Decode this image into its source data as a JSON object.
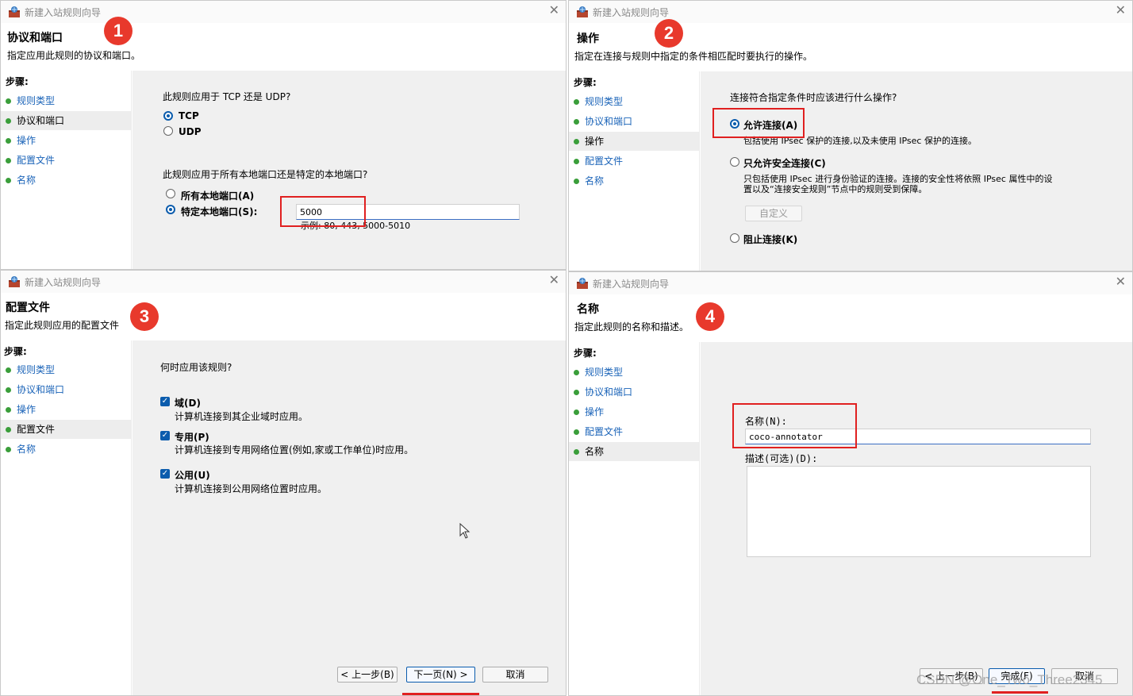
{
  "window_title": "新建入站规则向导",
  "close_glyph": "✕",
  "steps_label": "步骤:",
  "steps": [
    "规则类型",
    "协议和端口",
    "操作",
    "配置文件",
    "名称"
  ],
  "badges": [
    "1",
    "2",
    "3",
    "4"
  ],
  "panel1": {
    "header_title": "协议和端口",
    "header_sub": "指定应用此规则的协议和端口。",
    "q1": "此规则应用于 TCP 还是 UDP?",
    "opt_tcp": "TCP",
    "opt_udp": "UDP",
    "q2": "此规则应用于所有本地端口还是特定的本地端口?",
    "opt_all_ports": "所有本地端口(A)",
    "opt_specific_ports": "特定本地端口(S):",
    "port_value": "5000",
    "port_example": "示例: 80, 443, 5000-5010"
  },
  "panel2": {
    "header_title": "操作",
    "header_sub": "指定在连接与规则中指定的条件相匹配时要执行的操作。",
    "question": "连接符合指定条件时应该进行什么操作?",
    "opt_allow": "允许连接(A)",
    "opt_allow_desc": "包括使用 IPsec 保护的连接,以及未使用 IPsec 保护的连接。",
    "opt_secure": "只允许安全连接(C)",
    "opt_secure_desc_1": "只包括使用 IPsec 进行身份验证的连接。连接的安全性将依照 IPsec 属性中的设",
    "opt_secure_desc_2": "置以及“连接安全规则”节点中的规则受到保障。",
    "customize_button": "自定义",
    "opt_block": "阻止连接(K)"
  },
  "panel3": {
    "header_title": "配置文件",
    "header_sub": "指定此规则应用的配置文件",
    "question": "何时应用该规则?",
    "domain_label": "域(D)",
    "domain_desc": "计算机连接到其企业域时应用。",
    "private_label": "专用(P)",
    "private_desc": "计算机连接到专用网络位置(例如,家或工作单位)时应用。",
    "public_label": "公用(U)",
    "public_desc": "计算机连接到公用网络位置时应用。",
    "back_button": "< 上一步(B)",
    "next_button": "下一页(N) >",
    "cancel_button": "取消"
  },
  "panel4": {
    "header_title": "名称",
    "header_sub": "指定此规则的名称和描述。",
    "name_label": "名称(N):",
    "name_value": "coco-annotator",
    "desc_label": "描述(可选)(D):",
    "back_button": "< 上一步(B)",
    "finish_button": "完成(F)",
    "cancel_button": "取消"
  },
  "watermark": "CSDN @One_Two_Three2345",
  "accent_color": "#0b5cad",
  "highlight_color": "#e02020",
  "link_color": "#1a63b8"
}
